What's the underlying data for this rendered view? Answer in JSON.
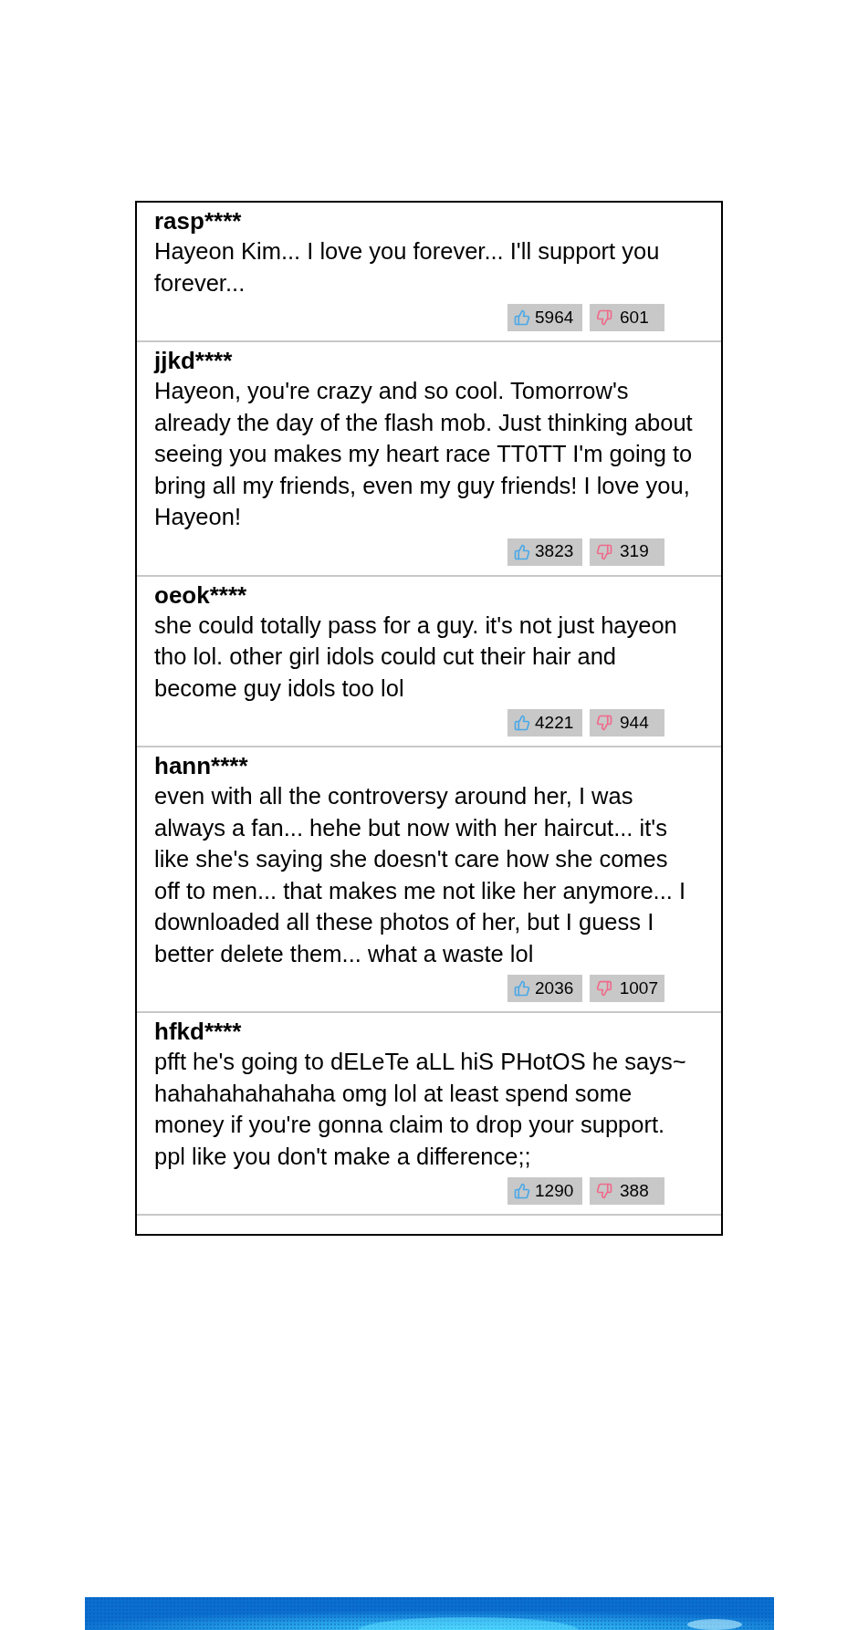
{
  "comments": [
    {
      "username": "rasp****",
      "text": "Hayeon Kim... I love you forever... I'll support you forever...",
      "likes": "5964",
      "dislikes": "601"
    },
    {
      "username": "jjkd****",
      "text": "Hayeon, you're crazy and so cool. Tomorrow's already the day of the flash mob. Just thinking about seeing you makes my heart race TT0TT I'm going to bring all my friends, even my guy friends! I love you, Hayeon!",
      "likes": "3823",
      "dislikes": "319"
    },
    {
      "username": "oeok****",
      "text": "she could totally pass for a guy. it's not just hayeon tho lol. other girl idols could cut their hair and become guy idols too lol",
      "likes": "4221",
      "dislikes": "944"
    },
    {
      "username": "hann****",
      "text": "even with all the controversy around her, I was always a fan... hehe but now with her haircut... it's like she's saying she doesn't care how she comes off to men... that makes me not like her anymore... I downloaded all these photos of her, but I guess I better delete them... what a waste lol",
      "likes": "2036",
      "dislikes": "1007"
    },
    {
      "username": "hfkd****",
      "text": "pfft he's going to dELeTe aLL hiS PHotOS he says~ hahahahahahaha omg lol at least spend some money if you're gonna claim to drop your support. ppl like you don't make a difference;;",
      "likes": "1290",
      "dislikes": "388"
    }
  ]
}
